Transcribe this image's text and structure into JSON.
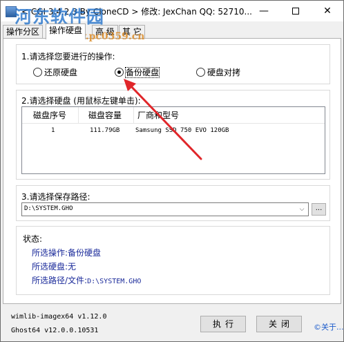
{
  "window": {
    "title": "< CGI 3.4.2.3 By CloneCD > 修改: JexChan  QQ: 52710...",
    "minimize_glyph": "—",
    "close_glyph": "✕"
  },
  "watermark": {
    "text": "河东软件园",
    "url": "www.pc0359.cn"
  },
  "tabs": [
    {
      "label": "操作分区",
      "active": false
    },
    {
      "label": "操作硬盘",
      "active": true
    },
    {
      "label": "高 级",
      "active": false
    },
    {
      "label": "其 它",
      "active": false
    }
  ],
  "step1": {
    "title": "1.请选择您要进行的操作:",
    "options": [
      {
        "label": "还原硬盘",
        "checked": false
      },
      {
        "label": "备份硬盘",
        "checked": true
      },
      {
        "label": "硬盘对拷",
        "checked": false
      }
    ]
  },
  "step2": {
    "title": "2.请选择硬盘 (用鼠标左键单击):",
    "columns": [
      "磁盘序号",
      "磁盘容量",
      "厂商和型号"
    ],
    "rows": [
      {
        "index": "1",
        "size": "111.79GB",
        "model": "Samsung SSD 750 EVO 120GB"
      }
    ]
  },
  "step3": {
    "title": "3.请选择保存路径:",
    "path_value": "D:\\SYSTEM.GHO",
    "browse_label": "...",
    "dropdown_glyph": "⌵"
  },
  "status": {
    "heading": "状态:",
    "operation_label": "所选操作:",
    "operation_value": "备份硬盘",
    "disk_label": "所选硬盘:",
    "disk_value": "无",
    "path_label": "所选路径/文件:",
    "path_value": "D:\\SYSTEM.GHO"
  },
  "footer": {
    "wimlib": "wimlib-imagex64 v1.12.0",
    "ghost": "Ghost64 v12.0.0.10531",
    "execute_label": "执行",
    "close_label": "关闭",
    "about_link": "©关于..."
  },
  "colors": {
    "status_blue": "#1a2a9a",
    "annotation_arrow": "#e0262a",
    "link": "#1a5acb"
  }
}
